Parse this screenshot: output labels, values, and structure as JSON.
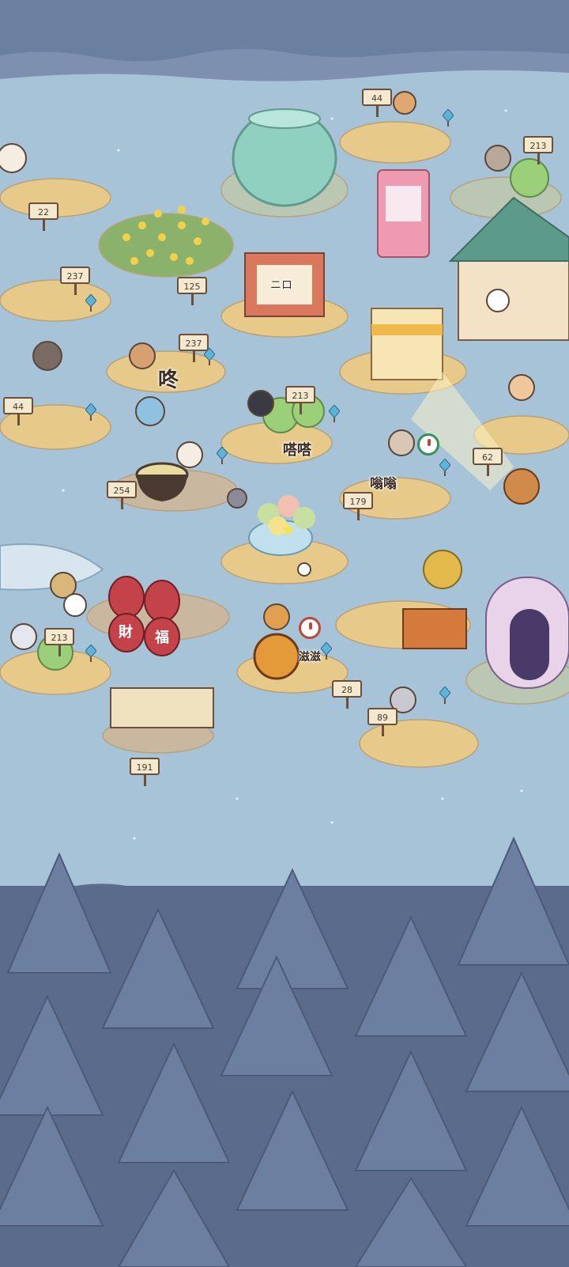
{
  "colors": {
    "lake": "#a7c3d7",
    "rock": "#6b7fa0",
    "forest": "#5a6b8b",
    "tree": "#6d7fa0",
    "island": "#e7c98a",
    "grass": "#8bb26b",
    "sign": "#f4e8cf",
    "fish": "#5fb3d8"
  },
  "signs": [
    {
      "id": "sign-44-top",
      "value": "44"
    },
    {
      "id": "sign-213-right",
      "value": "213"
    },
    {
      "id": "sign-22",
      "value": "22"
    },
    {
      "id": "sign-237-left",
      "value": "237"
    },
    {
      "id": "sign-125",
      "value": "125"
    },
    {
      "id": "sign-237-mid",
      "value": "237"
    },
    {
      "id": "sign-44-left",
      "value": "44"
    },
    {
      "id": "sign-213-mid",
      "value": "213"
    },
    {
      "id": "sign-62",
      "value": "62"
    },
    {
      "id": "sign-254",
      "value": "254"
    },
    {
      "id": "sign-179",
      "value": "179"
    },
    {
      "id": "sign-213-low",
      "value": "213"
    },
    {
      "id": "sign-28",
      "value": "28"
    },
    {
      "id": "sign-89",
      "value": "89"
    },
    {
      "id": "sign-191",
      "value": "191"
    }
  ],
  "sounds": {
    "dong": "咚",
    "crunch": "嗒嗒",
    "slurp": "嗡嗡",
    "sizzle": "滋滋"
  },
  "jars": {
    "jar_a": "財",
    "jar_b": "福"
  },
  "bulletin": {
    "line1": "ニロ"
  },
  "icons": [
    "fish-post-icon",
    "timer-icon",
    "star-icon"
  ]
}
